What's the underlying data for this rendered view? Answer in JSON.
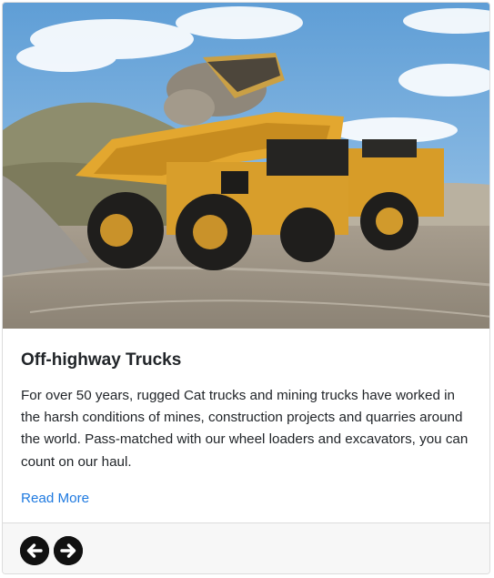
{
  "card": {
    "image_alt": "Cat off-highway truck being loaded",
    "title": "Off-highway Trucks",
    "description": "For over 50 years, rugged Cat trucks and mining trucks have worked in the harsh conditions of mines, construction projects and quarries around the world. Pass-matched with our wheel loaders and excavators, you can count on our haul.",
    "read_more_label": "Read More"
  },
  "footer": {
    "prev_icon": "arrow-left-circle-icon",
    "next_icon": "arrow-right-circle-icon"
  },
  "colors": {
    "link": "#1f7ae0",
    "truck_yellow": "#e3a72f",
    "footer_bg": "#f7f7f7"
  }
}
